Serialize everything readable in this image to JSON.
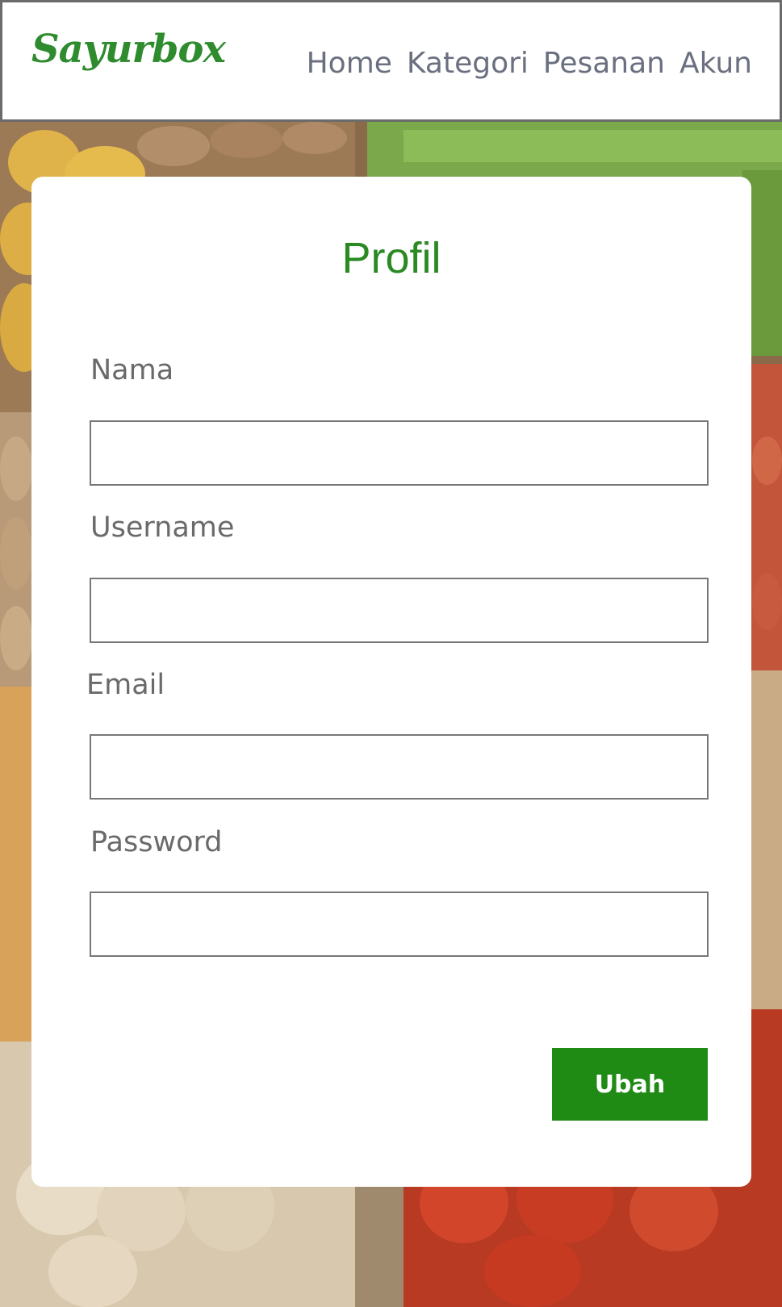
{
  "header": {
    "logo": "Sayurbox",
    "nav": [
      {
        "label": "Home"
      },
      {
        "label": "Kategori"
      },
      {
        "label": "Pesanan"
      },
      {
        "label": "Akun"
      }
    ]
  },
  "profile": {
    "title": "Profil",
    "fields": [
      {
        "label": "Nama",
        "value": "",
        "placeholder": ""
      },
      {
        "label": "Username",
        "value": "",
        "placeholder": ""
      },
      {
        "label": "Email",
        "value": "",
        "placeholder": ""
      },
      {
        "label": "Password",
        "value": "",
        "placeholder": ""
      }
    ],
    "submit_label": "Ubah"
  },
  "colors": {
    "brand_green": "#2e8b2e",
    "title_green": "#2a8a22",
    "button_green": "#1f8a14",
    "nav_text": "#6b7080"
  }
}
